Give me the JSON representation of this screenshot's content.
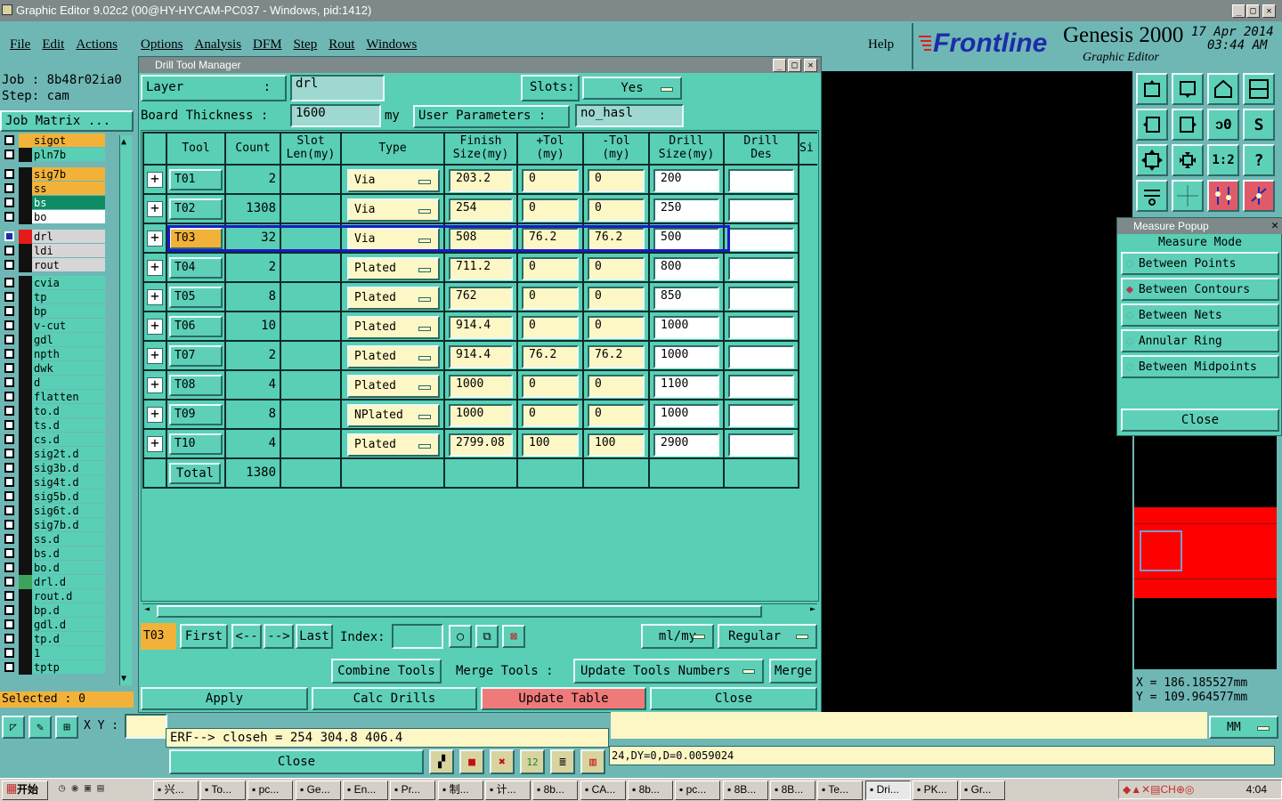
{
  "window": {
    "title": "Graphic Editor 9.02c2 (00@HY-HYCAM-PC037 - Windows, pid:1412)"
  },
  "menu": {
    "file": "File",
    "edit": "Edit",
    "actions": "Actions",
    "options": "Options",
    "analysis": "Analysis",
    "dfm": "DFM",
    "step": "Step",
    "rout": "Rout",
    "windows": "Windows",
    "help": "Help"
  },
  "brand": {
    "logo": "Frontline",
    "product": "Genesis 2000",
    "subtitle": "Graphic Editor",
    "date": "17 Apr 2014",
    "time": "03:44 AM"
  },
  "job": {
    "job_label": "Job : 8b48r02ia0",
    "step_label": "Step: cam",
    "matrix_button": "Job Matrix ..."
  },
  "layers": [
    {
      "name": "sigot",
      "color": "#f2b23a",
      "bg": "#f2b23a"
    },
    {
      "name": "pln7b",
      "color": "#111111",
      "bg": "#59cfb5"
    },
    {
      "name": "sig7b",
      "color": "#111111",
      "bg": "#f2b23a"
    },
    {
      "name": "ss",
      "color": "#111111",
      "bg": "#f2b23a"
    },
    {
      "name": "bs",
      "color": "#111111",
      "bg": "#0e8c63"
    },
    {
      "name": "bo",
      "color": "#111111",
      "bg": "#ffffff"
    },
    {
      "name": "drl",
      "color": "#e51b1b",
      "bg": "#d6d6d6"
    },
    {
      "name": "ldi",
      "color": "#111111",
      "bg": "#d6d6d6"
    },
    {
      "name": "rout",
      "color": "#111111",
      "bg": "#d6d6d6"
    },
    {
      "name": "cvia",
      "color": "#111111",
      "bg": "#59cfb5"
    },
    {
      "name": "tp",
      "color": "#111111",
      "bg": "#59cfb5"
    },
    {
      "name": "bp",
      "color": "#111111",
      "bg": "#59cfb5"
    },
    {
      "name": "v-cut",
      "color": "#111111",
      "bg": "#59cfb5"
    },
    {
      "name": "gdl",
      "color": "#111111",
      "bg": "#59cfb5"
    },
    {
      "name": "npth",
      "color": "#111111",
      "bg": "#59cfb5"
    },
    {
      "name": "dwk",
      "color": "#111111",
      "bg": "#59cfb5"
    },
    {
      "name": "d",
      "color": "#111111",
      "bg": "#59cfb5"
    },
    {
      "name": "flatten",
      "color": "#111111",
      "bg": "#59cfb5"
    },
    {
      "name": "to.d",
      "color": "#111111",
      "bg": "#59cfb5"
    },
    {
      "name": "ts.d",
      "color": "#111111",
      "bg": "#59cfb5"
    },
    {
      "name": "cs.d",
      "color": "#111111",
      "bg": "#59cfb5"
    },
    {
      "name": "sig2t.d",
      "color": "#111111",
      "bg": "#59cfb5"
    },
    {
      "name": "sig3b.d",
      "color": "#111111",
      "bg": "#59cfb5"
    },
    {
      "name": "sig4t.d",
      "color": "#111111",
      "bg": "#59cfb5"
    },
    {
      "name": "sig5b.d",
      "color": "#111111",
      "bg": "#59cfb5"
    },
    {
      "name": "sig6t.d",
      "color": "#111111",
      "bg": "#59cfb5"
    },
    {
      "name": "sig7b.d",
      "color": "#111111",
      "bg": "#59cfb5"
    },
    {
      "name": "ss.d",
      "color": "#111111",
      "bg": "#59cfb5"
    },
    {
      "name": "bs.d",
      "color": "#111111",
      "bg": "#59cfb5"
    },
    {
      "name": "bo.d",
      "color": "#111111",
      "bg": "#59cfb5"
    },
    {
      "name": "drl.d",
      "color": "#3da35a",
      "bg": "#59cfb5"
    },
    {
      "name": "rout.d",
      "color": "#111111",
      "bg": "#59cfb5"
    },
    {
      "name": "bp.d",
      "color": "#111111",
      "bg": "#59cfb5"
    },
    {
      "name": "gdl.d",
      "color": "#111111",
      "bg": "#59cfb5"
    },
    {
      "name": "tp.d",
      "color": "#111111",
      "bg": "#59cfb5"
    },
    {
      "name": "1",
      "color": "#111111",
      "bg": "#59cfb5"
    },
    {
      "name": "tptp",
      "color": "#111111",
      "bg": "#59cfb5"
    }
  ],
  "selected": "Selected : 0",
  "xy_label": "X Y :",
  "drill": {
    "title": "Drill Tool Manager",
    "layer_label": "Layer",
    "layer_colon": ":",
    "layer_value": "drl",
    "slots_label": "Slots:",
    "slots_value": "Yes",
    "board_thickness_label": "Board Thickness :",
    "board_thickness_value": "1600",
    "board_unit": "my",
    "user_params_label": "User Parameters :",
    "user_params_value": "no_hasl",
    "headers": {
      "tool": "Tool",
      "count": "Count",
      "slot1": "Slot",
      "slot2": "Len(my)",
      "type": "Type",
      "finish1": "Finish",
      "finish2": "Size(my)",
      "ptol1": "+Tol",
      "ptol2": "(my)",
      "mtol1": "-Tol",
      "mtol2": "(my)",
      "drill1": "Drill",
      "drill2": "Size(my)",
      "des1": "Drill",
      "des2": "Des",
      "si": "Si"
    },
    "rows": [
      {
        "tool": "T01",
        "count": "2",
        "type": "Via",
        "finish": "203.2",
        "ptol": "0",
        "mtol": "0",
        "drill": "200",
        "selected": false
      },
      {
        "tool": "T02",
        "count": "1308",
        "type": "Via",
        "finish": "254",
        "ptol": "0",
        "mtol": "0",
        "drill": "250",
        "selected": false
      },
      {
        "tool": "T03",
        "count": "32",
        "type": "Via",
        "finish": "508",
        "ptol": "76.2",
        "mtol": "76.2",
        "drill": "500",
        "selected": true
      },
      {
        "tool": "T04",
        "count": "2",
        "type": "Plated",
        "finish": "711.2",
        "ptol": "0",
        "mtol": "0",
        "drill": "800",
        "selected": false
      },
      {
        "tool": "T05",
        "count": "8",
        "type": "Plated",
        "finish": "762",
        "ptol": "0",
        "mtol": "0",
        "drill": "850",
        "selected": false
      },
      {
        "tool": "T06",
        "count": "10",
        "type": "Plated",
        "finish": "914.4",
        "ptol": "0",
        "mtol": "0",
        "drill": "1000",
        "selected": false
      },
      {
        "tool": "T07",
        "count": "2",
        "type": "Plated",
        "finish": "914.4",
        "ptol": "76.2",
        "mtol": "76.2",
        "drill": "1000",
        "selected": false
      },
      {
        "tool": "T08",
        "count": "4",
        "type": "Plated",
        "finish": "1000",
        "ptol": "0",
        "mtol": "0",
        "drill": "1100",
        "selected": false
      },
      {
        "tool": "T09",
        "count": "8",
        "type": "NPlated",
        "finish": "1000",
        "ptol": "0",
        "mtol": "0",
        "drill": "1000",
        "selected": false
      },
      {
        "tool": "T10",
        "count": "4",
        "type": "Plated",
        "finish": "2799.08",
        "ptol": "100",
        "mtol": "100",
        "drill": "2900",
        "selected": false
      }
    ],
    "total_label": "Total",
    "total_value": "1380",
    "current_tool": "T03",
    "nav": {
      "first": "First",
      "prev": "<--",
      "next": "-->",
      "last": "Last",
      "index_label": "Index:",
      "units": "ml/my",
      "mode": "Regular"
    },
    "actions": {
      "combine": "Combine Tools",
      "merge_tools_label": "Merge Tools :",
      "update_numbers": "Update Tools Numbers",
      "merge": "Merge"
    },
    "bottom": {
      "apply": "Apply",
      "calc": "Calc Drills",
      "update_table": "Update Table",
      "close": "Close"
    }
  },
  "measure": {
    "title": "Measure Popup",
    "mode_label": "Measure Mode",
    "options": [
      "Between Points",
      "Between Contours",
      "Between Nets",
      "Annular Ring",
      "Between Midpoints"
    ],
    "selected_index": 1,
    "close": "Close"
  },
  "coords": {
    "x": "X = 186.185527mm",
    "y": "Y = 109.964577mm"
  },
  "units_select": "MM",
  "console": {
    "message": "ERF--> closeh = 254 304.8 406.4",
    "close": "Close",
    "status": "24,DY=0,D=0.0059024"
  },
  "taskbar": {
    "start": "开始",
    "items": [
      "兴...",
      "To...",
      "pc...",
      "Ge...",
      "En...",
      "Pr...",
      "制...",
      "计...",
      "8b...",
      "CA...",
      "8b...",
      "pc...",
      "8B...",
      "8B...",
      "Te...",
      "Dri...",
      "PK...",
      "Gr..."
    ],
    "clock": "4:04"
  }
}
